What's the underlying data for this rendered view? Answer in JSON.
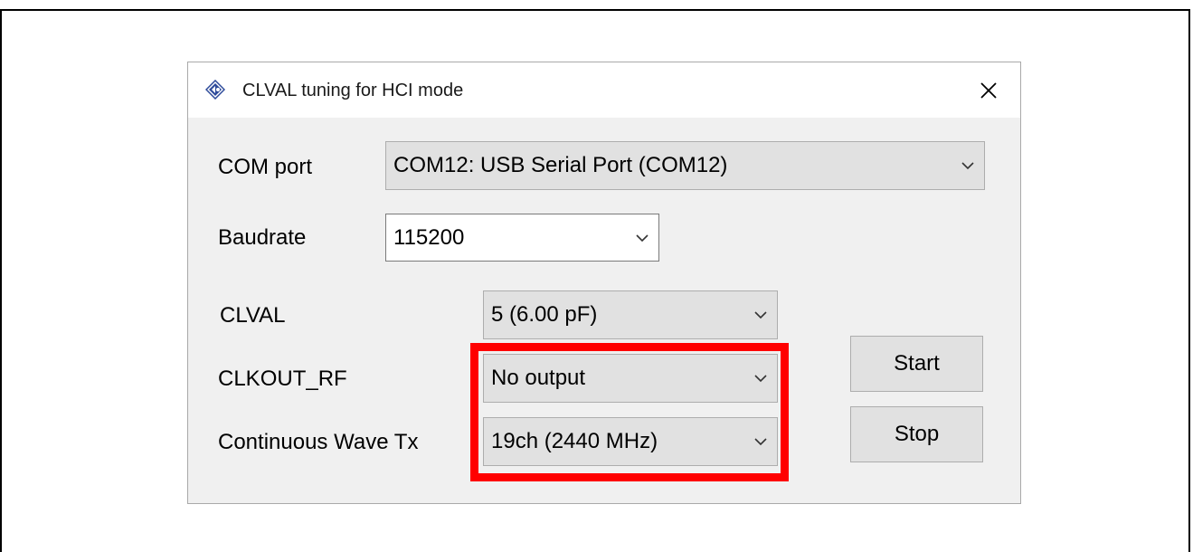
{
  "window": {
    "title": "CLVAL tuning for HCI mode"
  },
  "form": {
    "com_port": {
      "label": "COM port",
      "value": "COM12: USB Serial Port (COM12)"
    },
    "baudrate": {
      "label": "Baudrate",
      "value": "115200"
    },
    "clval": {
      "label": "CLVAL",
      "value": "5 (6.00 pF)"
    },
    "clkout_rf": {
      "label": "CLKOUT_RF",
      "value": "No output"
    },
    "continuous_wave_tx": {
      "label": "Continuous Wave Tx",
      "value": "19ch (2440 MHz)"
    }
  },
  "buttons": {
    "start_label": "Start",
    "stop_label": "Stop"
  },
  "colors": {
    "highlight": "#ff0000",
    "window_bg": "#f0f0f0",
    "control_bg": "#e1e1e1"
  }
}
